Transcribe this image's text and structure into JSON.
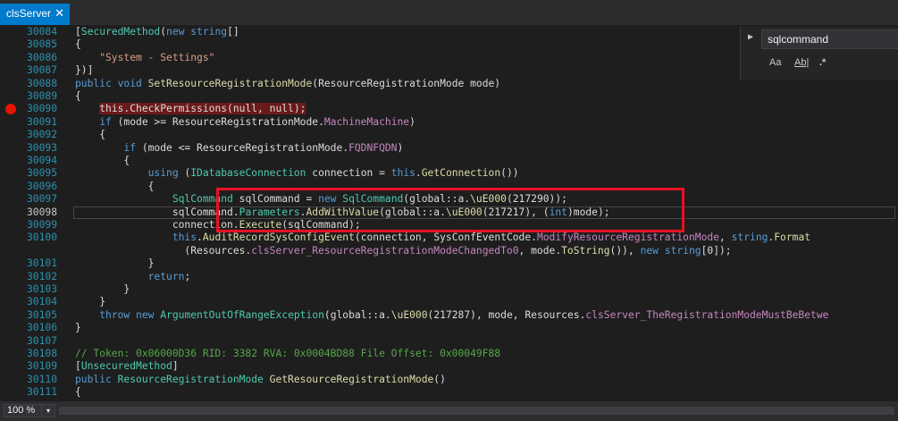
{
  "tab": {
    "title": "clsServer",
    "close": "✕"
  },
  "find": {
    "chevron": "▶",
    "query": "sqlcommand",
    "match_case": "Aa",
    "whole_word": "Ab|",
    "regex": ".*"
  },
  "status": {
    "zoom": "100 %",
    "zoom_dropdown": "▾"
  },
  "highlight_color": "#e81123",
  "lines": [
    {
      "n": "30084",
      "tokens": [
        [
          "[",
          "p"
        ],
        [
          "SecuredMethod",
          "ty"
        ],
        [
          "(",
          "p"
        ],
        [
          "new ",
          "kw"
        ],
        [
          "string",
          "kw"
        ],
        [
          "[]",
          "p"
        ]
      ]
    },
    {
      "n": "30085",
      "tokens": [
        [
          "{",
          "p"
        ]
      ]
    },
    {
      "n": "30086",
      "tokens": [
        [
          "    \"System - Settings\"",
          "st"
        ]
      ]
    },
    {
      "n": "30087",
      "tokens": [
        [
          "})]",
          "p"
        ]
      ]
    },
    {
      "n": "30088",
      "tokens": [
        [
          "public ",
          "kw"
        ],
        [
          "void ",
          "kw"
        ],
        [
          "SetResourceRegistrationMode",
          "me"
        ],
        [
          "(ResourceRegistrationMode mode)",
          "p"
        ]
      ]
    },
    {
      "n": "30089",
      "tokens": [
        [
          "{",
          "p"
        ]
      ]
    },
    {
      "n": "30090",
      "bp": true,
      "tokens": [
        [
          "    ",
          "p"
        ],
        [
          "this.CheckPermissions(null, null);",
          "hl"
        ]
      ]
    },
    {
      "n": "30091",
      "tokens": [
        [
          "    ",
          "p"
        ],
        [
          "if ",
          "kw"
        ],
        [
          "(mode >= ResourceRegistrationMode.",
          "p"
        ],
        [
          "MachineMachine",
          "pr"
        ],
        [
          ")",
          "p"
        ]
      ]
    },
    {
      "n": "30092",
      "tokens": [
        [
          "    {",
          "p"
        ]
      ]
    },
    {
      "n": "30093",
      "tokens": [
        [
          "        ",
          "p"
        ],
        [
          "if ",
          "kw"
        ],
        [
          "(mode <= ResourceRegistrationMode.",
          "p"
        ],
        [
          "FQDNFQDN",
          "pr"
        ],
        [
          ")",
          "p"
        ]
      ]
    },
    {
      "n": "30094",
      "tokens": [
        [
          "        {",
          "p"
        ]
      ]
    },
    {
      "n": "30095",
      "tokens": [
        [
          "            ",
          "p"
        ],
        [
          "using ",
          "kw"
        ],
        [
          "(",
          "p"
        ],
        [
          "IDatabaseConnection",
          "ty"
        ],
        [
          " connection = ",
          "p"
        ],
        [
          "this",
          "kw"
        ],
        [
          ".",
          "p"
        ],
        [
          "GetConnection",
          "me"
        ],
        [
          "())",
          "p"
        ]
      ]
    },
    {
      "n": "30096",
      "tokens": [
        [
          "            {",
          "p"
        ]
      ]
    },
    {
      "n": "30097",
      "tokens": [
        [
          "                ",
          "p"
        ],
        [
          "SqlCommand",
          "ty"
        ],
        [
          " sqlCommand = ",
          "p"
        ],
        [
          "new ",
          "kw"
        ],
        [
          "SqlCommand",
          "ty"
        ],
        [
          "(global::a.",
          "p"
        ],
        [
          "\\uE000",
          "me"
        ],
        [
          "(217290));",
          "p"
        ]
      ]
    },
    {
      "n": "30098",
      "cur": true,
      "tokens": [
        [
          "                sqlCommand.",
          "p"
        ],
        [
          "Parameters",
          "ty"
        ],
        [
          ".",
          "p"
        ],
        [
          "AddWithValue",
          "me"
        ],
        [
          "(global::a.",
          "p"
        ],
        [
          "\\uE000",
          "me"
        ],
        [
          "(217217), (",
          "p"
        ],
        [
          "int",
          "kw"
        ],
        [
          ")mode);",
          "p"
        ]
      ]
    },
    {
      "n": "30099",
      "tokens": [
        [
          "                connection.",
          "p"
        ],
        [
          "Execute",
          "me"
        ],
        [
          "(sqlCommand);",
          "p"
        ]
      ]
    },
    {
      "n": "30100",
      "tokens": [
        [
          "                ",
          "p"
        ],
        [
          "this",
          "kw"
        ],
        [
          ".",
          "p"
        ],
        [
          "AuditRecordSysConfigEvent",
          "me"
        ],
        [
          "(connection, SysConfEventCode.",
          "p"
        ],
        [
          "ModifyResourceRegistrationMode",
          "pr"
        ],
        [
          ", ",
          "p"
        ],
        [
          "string",
          "kw"
        ],
        [
          ".",
          "p"
        ],
        [
          "Format",
          "me"
        ]
      ]
    },
    {
      "n": "",
      "tokens": [
        [
          "                  (Resources.",
          "p"
        ],
        [
          "clsServer_ResourceRegistrationModeChangedTo0",
          "pr"
        ],
        [
          ", mode.",
          "p"
        ],
        [
          "ToString",
          "me"
        ],
        [
          "()), ",
          "p"
        ],
        [
          "new ",
          "kw"
        ],
        [
          "string",
          "kw"
        ],
        [
          "[0]);",
          "p"
        ]
      ]
    },
    {
      "n": "30101",
      "tokens": [
        [
          "            }",
          "p"
        ]
      ]
    },
    {
      "n": "30102",
      "tokens": [
        [
          "            ",
          "p"
        ],
        [
          "return",
          "kw"
        ],
        [
          ";",
          "p"
        ]
      ]
    },
    {
      "n": "30103",
      "tokens": [
        [
          "        }",
          "p"
        ]
      ]
    },
    {
      "n": "30104",
      "tokens": [
        [
          "    }",
          "p"
        ]
      ]
    },
    {
      "n": "30105",
      "tokens": [
        [
          "    ",
          "p"
        ],
        [
          "throw ",
          "kw"
        ],
        [
          "new ",
          "kw"
        ],
        [
          "ArgumentOutOfRangeException",
          "ty"
        ],
        [
          "(global::a.",
          "p"
        ],
        [
          "\\uE000",
          "me"
        ],
        [
          "(217287), mode, Resources.",
          "p"
        ],
        [
          "clsServer_TheRegistrationModeMustBeBetwe",
          "pr"
        ]
      ]
    },
    {
      "n": "30106",
      "tokens": [
        [
          "}",
          "p"
        ]
      ]
    },
    {
      "n": "30107",
      "tokens": []
    },
    {
      "n": "30108",
      "tokens": [
        [
          "// Token: 0x06000D36 RID: 3382 RVA: 0x0004BD88 File Offset: 0x00049F88",
          "cm"
        ]
      ]
    },
    {
      "n": "30109",
      "tokens": [
        [
          "[",
          "p"
        ],
        [
          "UnsecuredMethod",
          "ty"
        ],
        [
          "]",
          "p"
        ]
      ]
    },
    {
      "n": "30110",
      "tokens": [
        [
          "public ",
          "kw"
        ],
        [
          "ResourceRegistrationMode ",
          "ty"
        ],
        [
          "GetResourceRegistrationMode",
          "me"
        ],
        [
          "()",
          "p"
        ]
      ]
    },
    {
      "n": "30111",
      "tokens": [
        [
          "{",
          "p"
        ]
      ]
    }
  ]
}
